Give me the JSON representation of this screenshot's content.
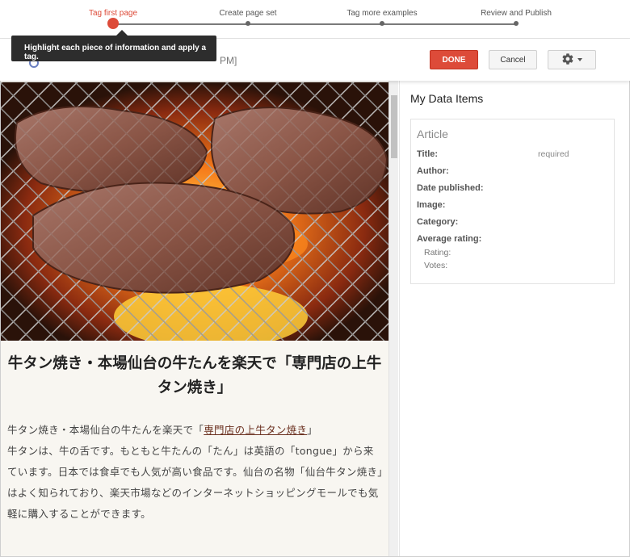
{
  "steps": [
    {
      "label": "Tag first page",
      "active": true
    },
    {
      "label": "Create page set",
      "active": false
    },
    {
      "label": "Tag more examples",
      "active": false
    },
    {
      "label": "Review and Publish",
      "active": false
    }
  ],
  "tooltip": {
    "text": "Highlight each piece of information and apply a tag."
  },
  "toolbar": {
    "url_fragment": "PM]",
    "done_label": "DONE",
    "cancel_label": "Cancel",
    "settings_icon": "gear-icon"
  },
  "article": {
    "title": "牛タン焼き・本場仙台の牛たんを楽天で「専門店の上牛タン焼き」",
    "intro_prefix": "牛タン焼き・本場仙台の牛たんを楽天で「",
    "intro_link": "専門店の上牛タン焼き",
    "intro_suffix": "」",
    "body": "牛タンは、牛の舌です。もともと牛たんの「たん」は英語の「tongue」から来ています。日本では食卓でも人気が高い食品です。仙台の名物「仙台牛タン焼き」はよく知られており、楽天市場などのインターネットショッピングモールでも気軽に購入することができます。"
  },
  "sidebar": {
    "title": "My Data Items",
    "card_title": "Article",
    "fields": [
      {
        "label": "Title:"
      },
      {
        "label": "Author:"
      },
      {
        "label": "Date published:"
      },
      {
        "label": "Image:"
      },
      {
        "label": "Category:"
      },
      {
        "label": "Average rating:"
      }
    ],
    "subfields": [
      {
        "label": "Rating:"
      },
      {
        "label": "Votes:"
      }
    ],
    "required_label": "required"
  },
  "colors": {
    "accent": "#dd4b39",
    "tooltip_bg": "#2d2d2d",
    "content_bg": "#f8f6f1"
  }
}
